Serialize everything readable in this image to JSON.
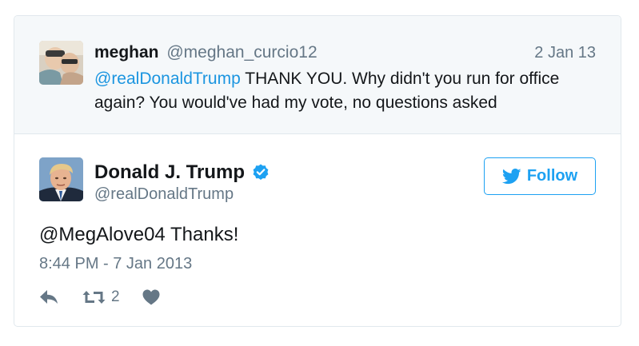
{
  "quoted_tweet": {
    "author_name": "meghan",
    "author_handle": "@meghan_curcio12",
    "date": "2 Jan 13",
    "mention": "@realDonaldTrump",
    "text": " THANK YOU. Why didn't you run for office again? You would've had my vote, no questions asked"
  },
  "main_tweet": {
    "author_name": "Donald J. Trump",
    "author_handle": "@realDonaldTrump",
    "verified": true,
    "text": "@MegAlove04 Thanks!",
    "timestamp": "8:44 PM - 7 Jan 2013",
    "retweet_count": "2"
  },
  "follow_button": {
    "label": "Follow"
  },
  "icons": {
    "verified": "verified-badge-icon",
    "follow": "twitter-bird-icon",
    "reply": "reply-icon",
    "retweet": "retweet-icon",
    "like": "heart-icon"
  },
  "colors": {
    "accent": "#1da1f2",
    "link": "#1b95e0",
    "muted": "#657786",
    "text": "#14171a",
    "quoted_background": "#f5f8fa",
    "border": "#e1e8ed"
  }
}
